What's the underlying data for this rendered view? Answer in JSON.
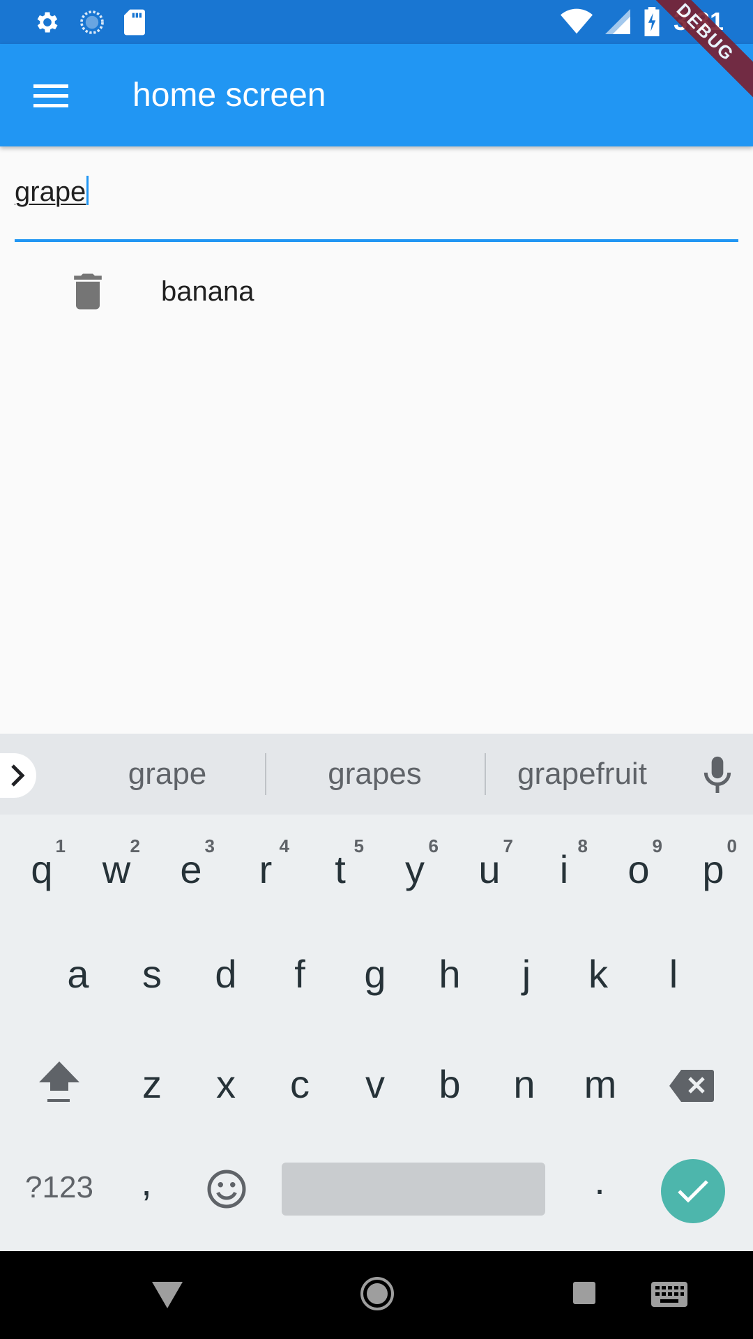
{
  "status_bar": {
    "time": "3:31",
    "icons": [
      "gear-icon",
      "sync-icon",
      "sd-card-icon",
      "wifi-icon",
      "signal-icon",
      "battery-charging-icon"
    ]
  },
  "app_bar": {
    "title": "home screen",
    "menu_icon": "hamburger-menu-icon",
    "color": "#2196f3"
  },
  "debug_banner": "DEBUG",
  "text_field": {
    "value": "grape"
  },
  "list": {
    "items": [
      {
        "label": "banana",
        "icon": "trash-icon"
      }
    ]
  },
  "keyboard": {
    "suggestions": [
      "grape",
      "grapes",
      "grapefruit"
    ],
    "row1": [
      {
        "key": "q",
        "hint": "1"
      },
      {
        "key": "w",
        "hint": "2"
      },
      {
        "key": "e",
        "hint": "3"
      },
      {
        "key": "r",
        "hint": "4"
      },
      {
        "key": "t",
        "hint": "5"
      },
      {
        "key": "y",
        "hint": "6"
      },
      {
        "key": "u",
        "hint": "7"
      },
      {
        "key": "i",
        "hint": "8"
      },
      {
        "key": "o",
        "hint": "9"
      },
      {
        "key": "p",
        "hint": "0"
      }
    ],
    "row2": [
      "a",
      "s",
      "d",
      "f",
      "g",
      "h",
      "j",
      "k",
      "l"
    ],
    "row3": [
      "z",
      "x",
      "c",
      "v",
      "b",
      "n",
      "m"
    ],
    "symbols_key": "?123",
    "comma_key": ",",
    "period_key": ".",
    "enter_color": "#4db6ac"
  },
  "nav_bar": {
    "buttons": [
      "back-icon",
      "home-icon",
      "recents-icon",
      "keyboard-icon"
    ]
  }
}
